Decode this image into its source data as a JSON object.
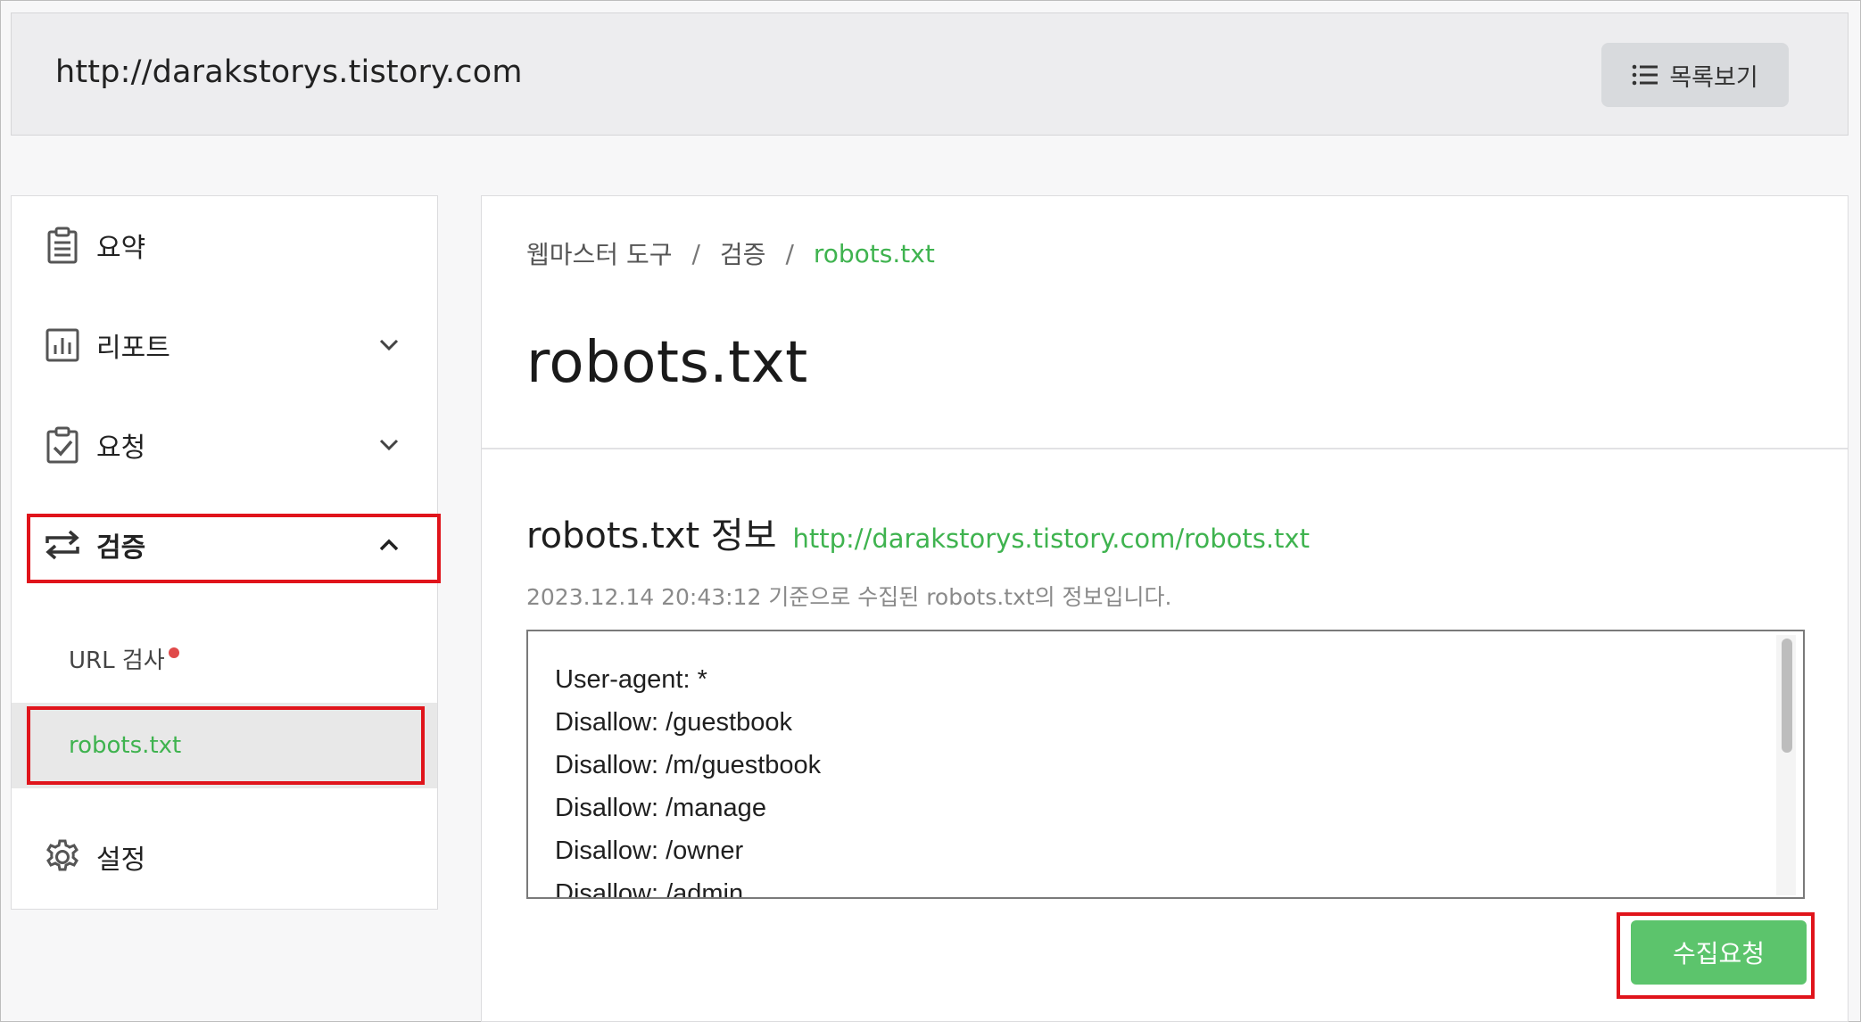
{
  "header": {
    "site_url": "http://darakstorys.tistory.com",
    "list_button_label": "목록보기",
    "list_icon": "list-icon"
  },
  "sidebar": {
    "items": [
      {
        "label": "요약",
        "icon": "clipboard-icon"
      },
      {
        "label": "리포트",
        "icon": "bar-chart-icon",
        "expanded": false
      },
      {
        "label": "요청",
        "icon": "clipboard-check-icon",
        "expanded": false
      },
      {
        "label": "검증",
        "icon": "swap-arrows-icon",
        "expanded": true,
        "active": true
      },
      {
        "label": "설정",
        "icon": "gear-icon"
      }
    ],
    "sub_items": [
      {
        "label": "URL 검사",
        "has_dot": true
      },
      {
        "label": "robots.txt",
        "active": true
      }
    ]
  },
  "main": {
    "breadcrumb": [
      "웹마스터 도구",
      "검증",
      "robots.txt"
    ],
    "breadcrumb_separator": "/",
    "title": "robots.txt",
    "section_title": "robots.txt 정보",
    "section_link": "http://darakstorys.tistory.com/robots.txt",
    "collected_note": "2023.12.14 20:43:12 기준으로 수집된 robots.txt의 정보입니다.",
    "robots_lines": [
      "User-agent: *",
      "Disallow: /guestbook",
      "Disallow: /m/guestbook",
      "Disallow: /manage",
      "Disallow: /owner",
      "Disallow: /admin"
    ],
    "submit_label": "수집요청"
  },
  "colors": {
    "accent_green": "#3fb34f",
    "button_green": "#5cc46c",
    "highlight_red": "#e0141b",
    "notification_dot": "#e04a4a"
  }
}
